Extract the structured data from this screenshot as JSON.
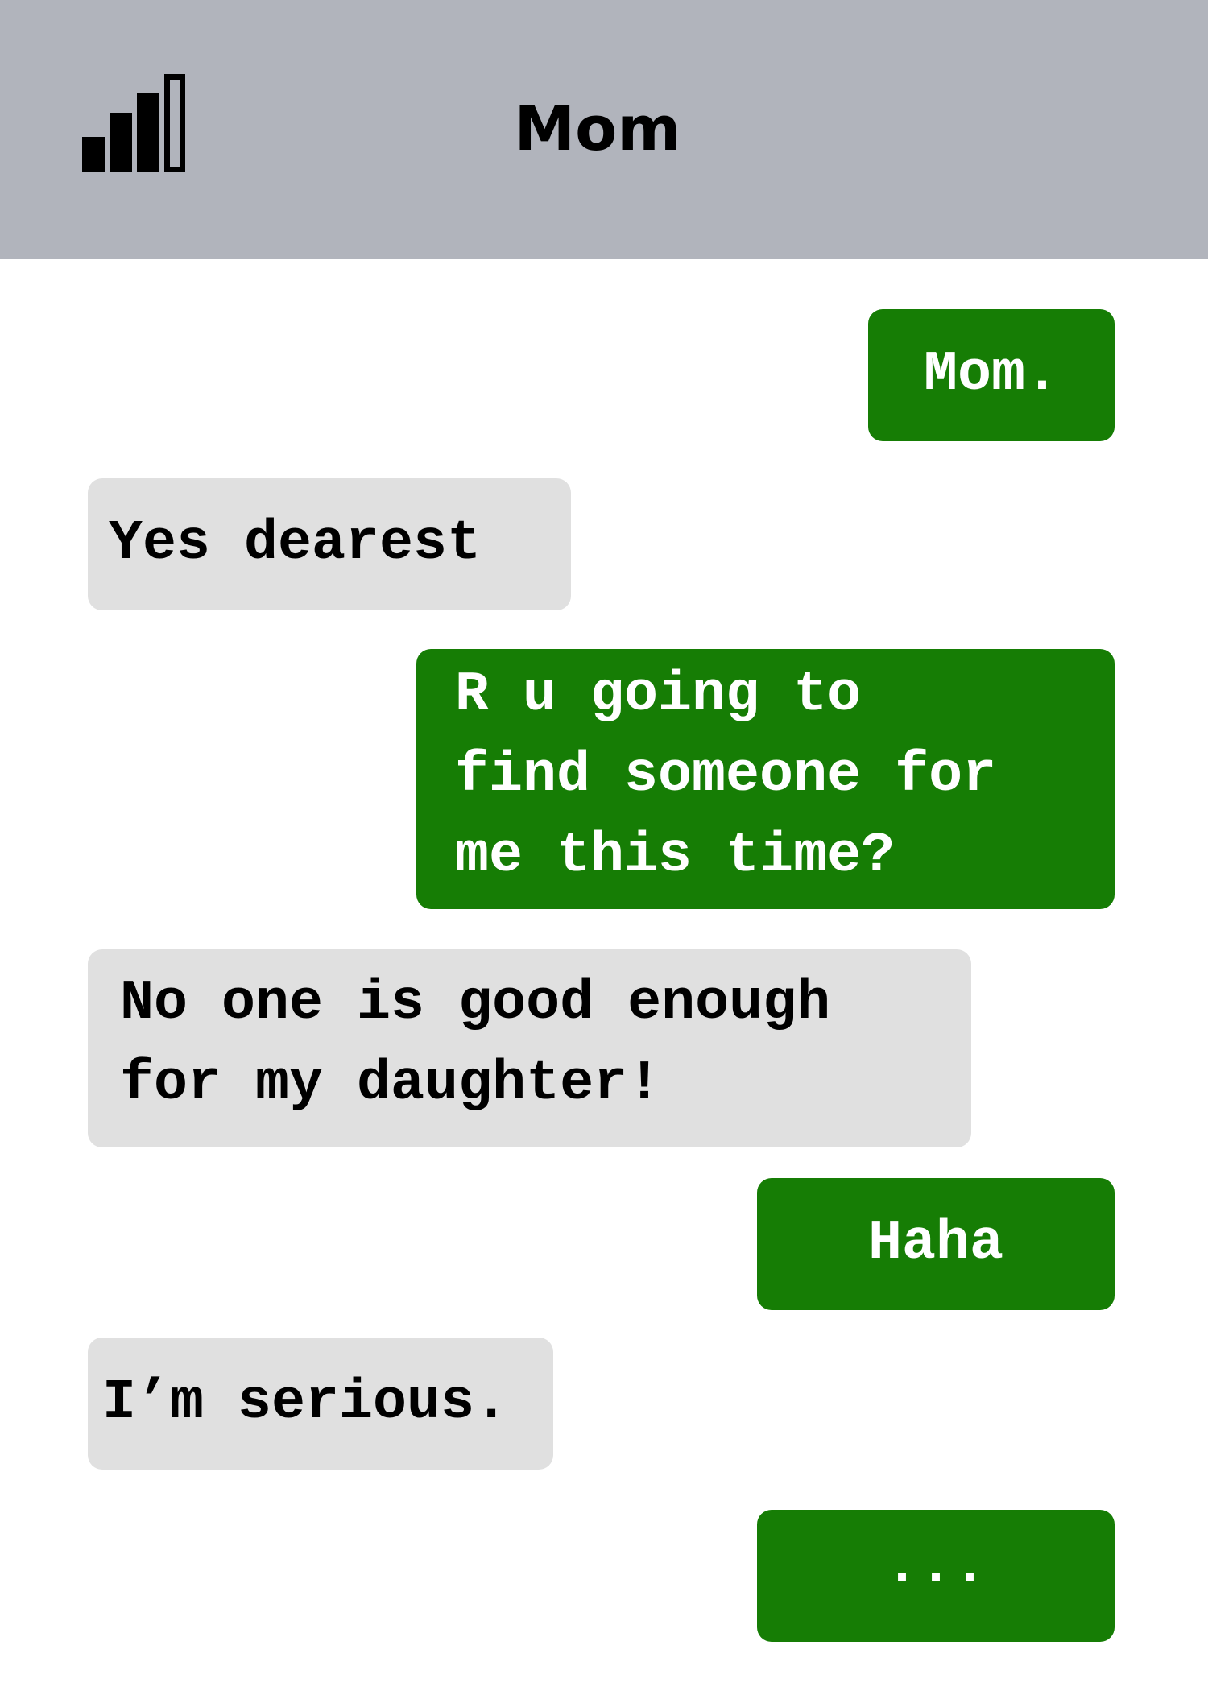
{
  "header": {
    "title": "Mom",
    "icon": "signal-strength-icon"
  },
  "colors": {
    "header_bg": "#b1b4bc",
    "sent_bubble": "#167d05",
    "received_bubble": "#e0e0e0"
  },
  "messages": [
    {
      "sender": "me",
      "text": "Mom."
    },
    {
      "sender": "mom",
      "text": "Yes dearest"
    },
    {
      "sender": "me",
      "text": "R u going to\nfind someone for\nme this time?"
    },
    {
      "sender": "mom",
      "text": "No one is good enough\nfor my daughter!"
    },
    {
      "sender": "me",
      "text": "Haha"
    },
    {
      "sender": "mom",
      "text": "I’m serious."
    },
    {
      "sender": "me",
      "text": "..."
    }
  ]
}
